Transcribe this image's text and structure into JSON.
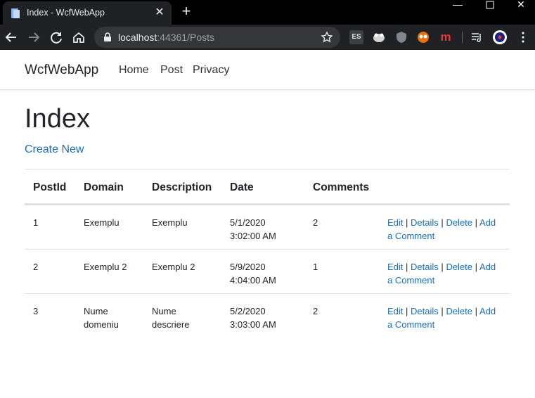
{
  "browser": {
    "tab_title": "Index - WcfWebApp",
    "url_host": "localhost",
    "url_rest": ":44361/Posts",
    "extensions": [
      "ES",
      "ud",
      "m"
    ]
  },
  "site": {
    "brand": "WcfWebApp",
    "nav": [
      "Home",
      "Post",
      "Privacy"
    ],
    "heading": "Index",
    "create_new": "Create New"
  },
  "table": {
    "headers": [
      "PostId",
      "Domain",
      "Description",
      "Date",
      "Comments"
    ],
    "rows": [
      {
        "id": "1",
        "domain": "Exemplu",
        "description": "Exemplu",
        "date": "5/1/2020",
        "time": "3:02:00 AM",
        "comments": "2"
      },
      {
        "id": "2",
        "domain": "Exemplu 2",
        "description": "Exemplu 2",
        "date": "5/9/2020",
        "time": "4:04:00 AM",
        "comments": "1"
      },
      {
        "id": "3",
        "domain": "Nume domeniu",
        "description": "Nume descriere",
        "date": "5/2/2020",
        "time": "3:03:00 AM",
        "comments": "2"
      }
    ],
    "actions": {
      "edit": "Edit",
      "details": "Details",
      "delete": "Delete",
      "add_comment": "Add a Comment",
      "separator": "|"
    }
  },
  "colors": {
    "link": "#1b6ec2",
    "chrome_dark": "#202124",
    "tabstrip": "#000000"
  }
}
